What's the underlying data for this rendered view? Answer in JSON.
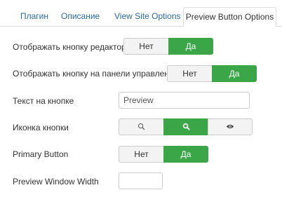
{
  "tabs": [
    {
      "label": "Плагин",
      "active": false
    },
    {
      "label": "Описание",
      "active": false
    },
    {
      "label": "View Site Options",
      "active": false
    },
    {
      "label": "Preview Button Options",
      "active": true
    }
  ],
  "fields": {
    "show_editor_button": {
      "label": "Отображать кнопку редактора",
      "options": [
        "Нет",
        "Да"
      ],
      "selected": "Да"
    },
    "show_toolbar_button": {
      "label": "Отображать кнопку на панели управления",
      "options": [
        "Нет",
        "Да"
      ],
      "selected": "Да"
    },
    "button_text": {
      "label": "Текст на кнопке",
      "value": "Preview"
    },
    "button_icon": {
      "label": "Иконка кнопки",
      "options": [
        "search-outline-icon",
        "search-bold-icon",
        "eye-icon"
      ],
      "selected": "search-bold-icon"
    },
    "primary_button": {
      "label": "Primary Button",
      "options": [
        "Нет",
        "Да"
      ],
      "selected": "Да"
    },
    "preview_window_width": {
      "label": "Preview Window Width",
      "value": ""
    }
  },
  "colors": {
    "active_green": "#3aa648",
    "tab_link": "#2a6aa7",
    "border": "#cccccc"
  }
}
